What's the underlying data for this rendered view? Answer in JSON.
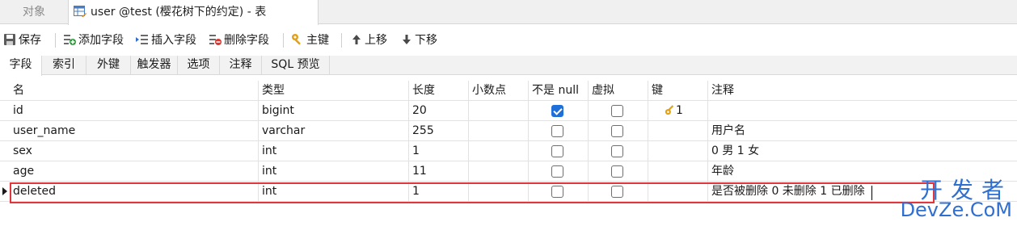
{
  "doc_tabs": [
    {
      "label": "对象"
    },
    {
      "label": "user @test (樱花树下的约定) - 表"
    }
  ],
  "toolbar": {
    "save": "保存",
    "add_field": "添加字段",
    "insert_field": "插入字段",
    "delete_field": "删除字段",
    "primary_key": "主键",
    "move_up": "上移",
    "move_down": "下移"
  },
  "sub_tabs": [
    "字段",
    "索引",
    "外键",
    "触发器",
    "选项",
    "注释",
    "SQL 预览"
  ],
  "columns": {
    "name": "名",
    "type": "类型",
    "length": "长度",
    "decimals": "小数点",
    "not_null": "不是 null",
    "virtual": "虚拟",
    "key": "键",
    "comment": "注释"
  },
  "rows": [
    {
      "name": "id",
      "type": "bigint",
      "length": "20",
      "decimals": "",
      "not_null": true,
      "virtual": false,
      "key": "1",
      "comment": ""
    },
    {
      "name": "user_name",
      "type": "varchar",
      "length": "255",
      "decimals": "",
      "not_null": false,
      "virtual": false,
      "key": "",
      "comment": "用户名"
    },
    {
      "name": "sex",
      "type": "int",
      "length": "1",
      "decimals": "",
      "not_null": false,
      "virtual": false,
      "key": "",
      "comment": "0 男 1 女"
    },
    {
      "name": "age",
      "type": "int",
      "length": "11",
      "decimals": "",
      "not_null": false,
      "virtual": false,
      "key": "",
      "comment": "年龄"
    },
    {
      "name": "deleted",
      "type": "int",
      "length": "1",
      "decimals": "",
      "not_null": false,
      "virtual": false,
      "key": "",
      "comment": "是否被删除 0 未删除 1 已删除"
    }
  ],
  "watermark": {
    "top": "开发者",
    "bottom": "DevZe.CoM"
  },
  "colors": {
    "accent": "#1e6fd9",
    "highlight": "#e0363c",
    "watermark": "#2f6fd0"
  }
}
